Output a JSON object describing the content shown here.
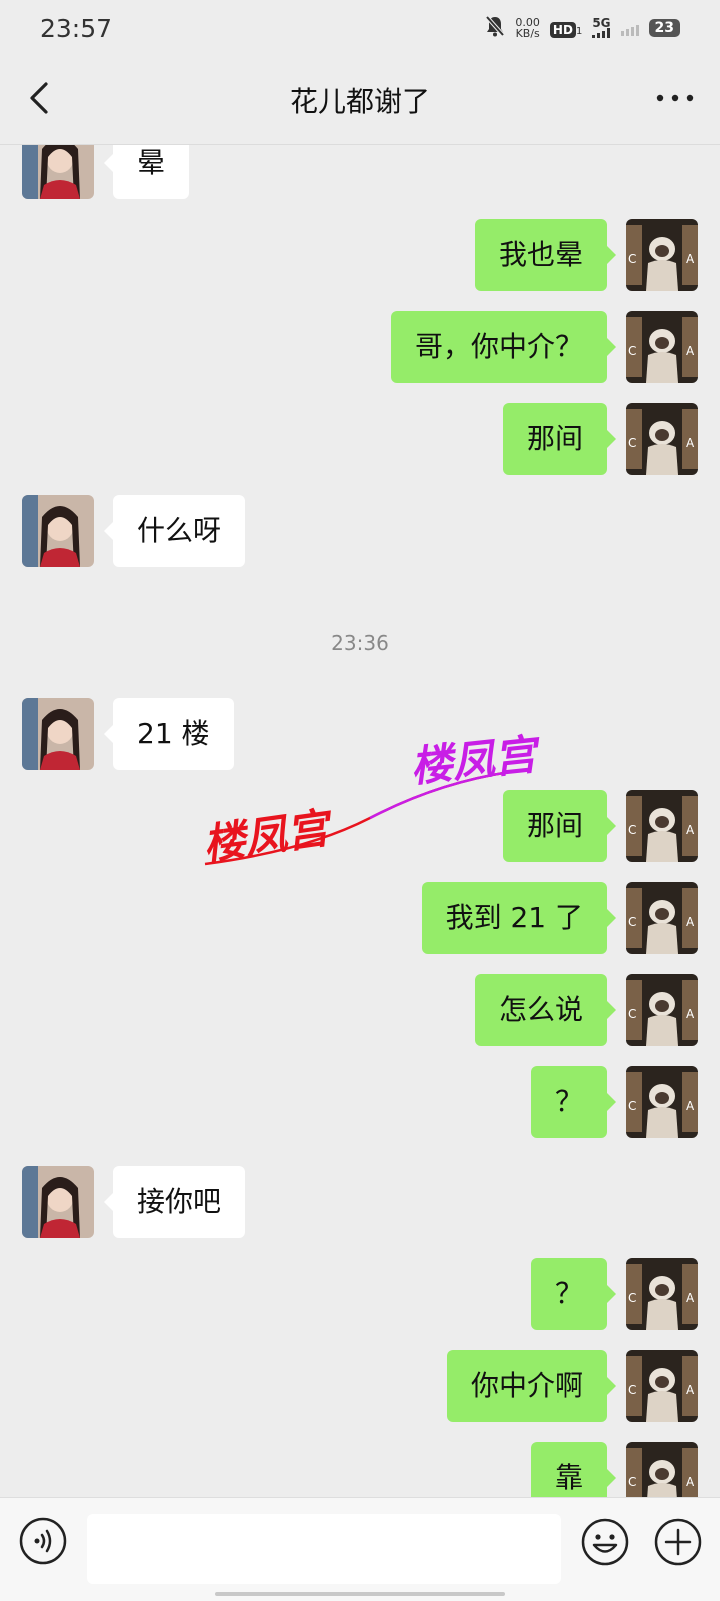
{
  "status_bar": {
    "time": "23:57",
    "net_speed": "0.00",
    "net_speed_unit": "KB/s",
    "hd_badge": "HD",
    "sim_index": "1",
    "network": "5G",
    "battery": "23"
  },
  "header": {
    "title": "花儿都谢了",
    "back_icon": "chevron-left-icon",
    "more_icon": "more-dots-icon"
  },
  "messages": [
    {
      "side": "left",
      "text": "晕"
    },
    {
      "side": "right",
      "text": "我也晕"
    },
    {
      "side": "right",
      "text": "哥，你中介？"
    },
    {
      "side": "right",
      "text": "那间"
    },
    {
      "side": "left",
      "text": "什么呀"
    },
    {
      "timestamp": "23:36"
    },
    {
      "side": "left",
      "text": "21 楼"
    },
    {
      "side": "right",
      "text": "那间"
    },
    {
      "side": "right",
      "text": "我到 21 了"
    },
    {
      "side": "right",
      "text": "怎么说"
    },
    {
      "side": "right",
      "text": "？"
    },
    {
      "side": "left",
      "text": "接你吧"
    },
    {
      "side": "right",
      "text": "？"
    },
    {
      "side": "right",
      "text": "你中介啊"
    },
    {
      "side": "right",
      "text": "靠"
    }
  ],
  "watermark": {
    "text_1": "楼凤宫",
    "text_2": "楼凤宫",
    "color_1": "#e8141e",
    "color_2": "#c81ee6"
  },
  "input_bar": {
    "value": "",
    "voice_icon": "voice-icon",
    "emoji_icon": "emoji-icon",
    "plus_icon": "plus-icon"
  },
  "colors": {
    "background": "#ededed",
    "sent_bubble": "#95ec69",
    "received_bubble": "#ffffff"
  }
}
